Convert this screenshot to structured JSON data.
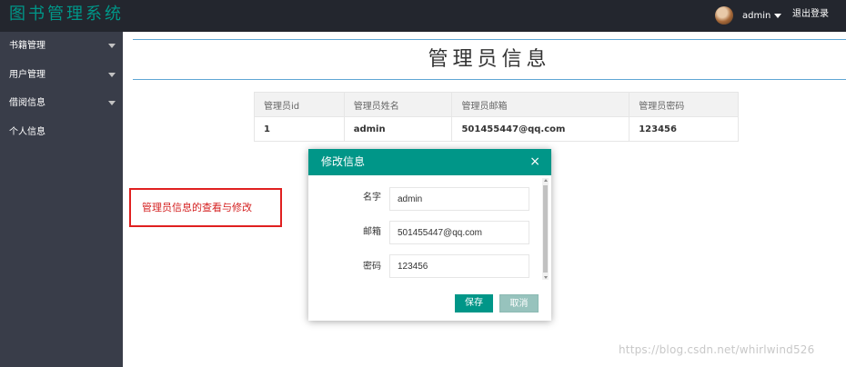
{
  "header": {
    "brand": "图书管理系统",
    "user_name": "admin",
    "logout_label": "退出登录"
  },
  "sidebar": {
    "items": [
      {
        "label": "书籍管理"
      },
      {
        "label": "用户管理"
      },
      {
        "label": "借阅信息"
      },
      {
        "label": "个人信息"
      }
    ]
  },
  "main": {
    "title": "管理员信息",
    "table": {
      "columns": [
        "管理员id",
        "管理员姓名",
        "管理员邮箱",
        "管理员密码"
      ],
      "rows": [
        [
          "1",
          "admin",
          "501455447@qq.com",
          "123456"
        ]
      ]
    },
    "note": "管理员信息的查看与修改"
  },
  "dialog": {
    "title": "修改信息",
    "close_symbol": "×",
    "fields": [
      {
        "label": "名字",
        "value": "admin"
      },
      {
        "label": "邮箱",
        "value": "501455447@qq.com"
      },
      {
        "label": "密码",
        "value": "123456"
      }
    ],
    "save_label": "保存",
    "cancel_label": "取消"
  },
  "watermark": "https://blog.csdn.net/whirlwind526",
  "colors": {
    "accent": "#009688",
    "topbar": "#23262e",
    "sidebar": "#393d49",
    "note_red": "#e02020"
  }
}
